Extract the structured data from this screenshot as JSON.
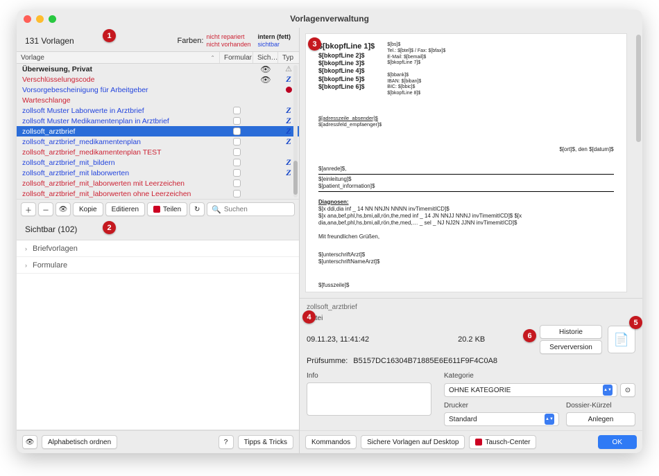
{
  "window_title": "Vorlagenverwaltung",
  "left": {
    "count": "131 Vorlagen",
    "colors_label": "Farben:",
    "colors": {
      "nr": "nicht repariert",
      "nv": "nicht vorhanden",
      "intern": "intern (fett)",
      "sichtbar": "sichtbar"
    },
    "headers": {
      "vorlage": "Vorlage",
      "formular": "Formular",
      "sich": "Sich…",
      "typ": "Typ"
    },
    "rows": [
      {
        "name": "Überweisung, Privat",
        "color": "black",
        "bold": true,
        "form": false,
        "eye": true,
        "typ": "warn"
      },
      {
        "name": "Verschlüsselungscode",
        "color": "red",
        "form": false,
        "eye": true,
        "typ": "z"
      },
      {
        "name": "Vorsorgebescheinigung für Arbeitgeber",
        "color": "blue",
        "form": false,
        "typ": "redball"
      },
      {
        "name": "Warteschlange",
        "color": "red",
        "form": false
      },
      {
        "name": "zollsoft Muster Laborwerte in Arztbrief",
        "color": "blue",
        "form": true,
        "typ": "z"
      },
      {
        "name": "zollsoft Muster Medikamentenplan in Arztbrief",
        "color": "blue",
        "form": true,
        "typ": "z"
      },
      {
        "name": "zollsoft_arztbrief",
        "color": "blue",
        "selected": true,
        "form": true,
        "typ": "z"
      },
      {
        "name": "zollsoft_arztbrief_medikamentenplan",
        "color": "blue",
        "form": true,
        "typ": "z"
      },
      {
        "name": "zollsoft_arztbrief_medikamentenplan TEST",
        "color": "red",
        "form": true
      },
      {
        "name": "zollsoft_arztbrief_mit_bildern",
        "color": "blue",
        "form": true,
        "typ": "z"
      },
      {
        "name": "zollsoft_arztbrief_mit laborwerten",
        "color": "blue",
        "form": true,
        "typ": "z"
      },
      {
        "name": "zollsoft_arztbrief_mit_laborwerten mit Leerzeichen",
        "color": "red",
        "form": true
      },
      {
        "name": "zollsoft_arztbrief_mit_laborwerten ohne Leerzeichen",
        "color": "red",
        "form": true
      }
    ],
    "toolbar": {
      "kopie": "Kopie",
      "editieren": "Editieren",
      "teilen": "Teilen",
      "suchen_placeholder": "Suchen"
    },
    "section": "Sichtbar (102)",
    "tree": [
      "Briefvorlagen",
      "Formulare"
    ],
    "bottom": {
      "alpha": "Alphabetisch ordnen",
      "tips": "Tipps & Tricks"
    }
  },
  "preview": {
    "bkopf": [
      "$[bkopfLine 1]$",
      "$[bkopfLine 2]$",
      "$[bkopfLine 3]$",
      "$[bkopfLine 4]$",
      "$[bkopfLine 5]$",
      "$[bkopfLine 6]$"
    ],
    "rcol": [
      "$[bs]$",
      "Tel.: $[btel]$ / Fax: $[bfax]$",
      "E-Mail: $[bemail]$",
      "$[bkopfLine 7]$",
      "",
      "$[bbank]$",
      "IBAN: $[biban]$",
      "BIC: $[bbic]$",
      "$[bkopfLine 8]$"
    ],
    "addr1": "$[adresszeile_absender]$",
    "addr2": "$[adressfeld_empfaenger]$",
    "dateline": "$[ort]$, den $[datum]$",
    "anrede": "$[anrede]$,",
    "einl": "$[einleitung]$",
    "pat": "$[patient_information]$",
    "diag_label": "Diagnosen:",
    "diag1": "$[x ddi,dia inf _ 14 NN NNJN NNNN invTimemitICD]$",
    "diag2": "$[x ana,bef,phl,hs,bmi,all,rön,the,med inf _ 14 JN NNJJ NNNJ invTimemitICD]$ $[x dia,ana,bef,phl,hs,bmi,all,rön,the,med,… _ sel _ NJ NJ2N JJNN invTimemitICD]$",
    "gruss": "Mit freundlichen Grüßen,",
    "sign1": "$[unterschriftArzt]$",
    "sign2": "$[unterschriftNameArzt]$",
    "fuss": "$[fusszeile]$"
  },
  "meta": {
    "filename": "zollsoft_arztbrief",
    "datei_label": "Datei",
    "date": "09.11.23, 11:41:42",
    "size": "20.2 KB",
    "historie": "Historie",
    "serverversion": "Serverversion",
    "checksum_label": "Prüfsumme: ",
    "checksum": "B5157DC16304B71885E6E611F9F4C0A8",
    "info_label": "Info",
    "kategorie_label": "Kategorie",
    "kategorie_value": "OHNE KATEGORIE",
    "drucker_label": "Drucker",
    "drucker_value": "Standard",
    "dossier_label": "Dossier-Kürzel",
    "anlegen": "Anlegen"
  },
  "right_bottom": {
    "kommandos": "Kommandos",
    "sichere": "Sichere Vorlagen auf Desktop",
    "tausch": "Tausch-Center",
    "ok": "OK"
  },
  "badges": [
    "1",
    "2",
    "3",
    "4",
    "5",
    "6"
  ]
}
